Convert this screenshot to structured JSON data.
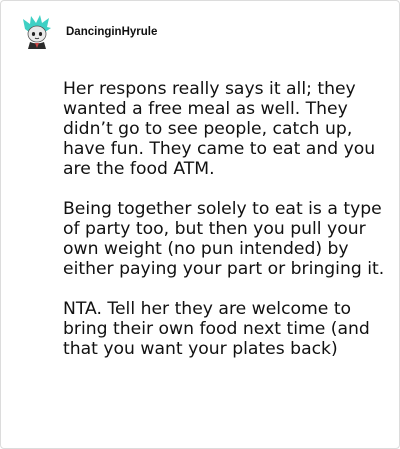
{
  "post": {
    "username": "DancinginHyrule",
    "avatar_icon": "cartoon-character-avatar-icon",
    "paragraphs": [
      "Her respons really says it all; they wanted a free meal as well. They didn’t go to see people, catch up, have fun. They came to eat and you are the food ATM.",
      "Being together solely to eat is a type of party too, but then you pull your own weight (no pun intended) by either paying your part or bringing it.",
      "NTA. Tell her they are welcome to bring their own food next time (and that you want your plates back)"
    ]
  },
  "colors": {
    "text": "#111111",
    "border": "#dcdcdc",
    "avatar_accent": "#3fd0c4"
  }
}
